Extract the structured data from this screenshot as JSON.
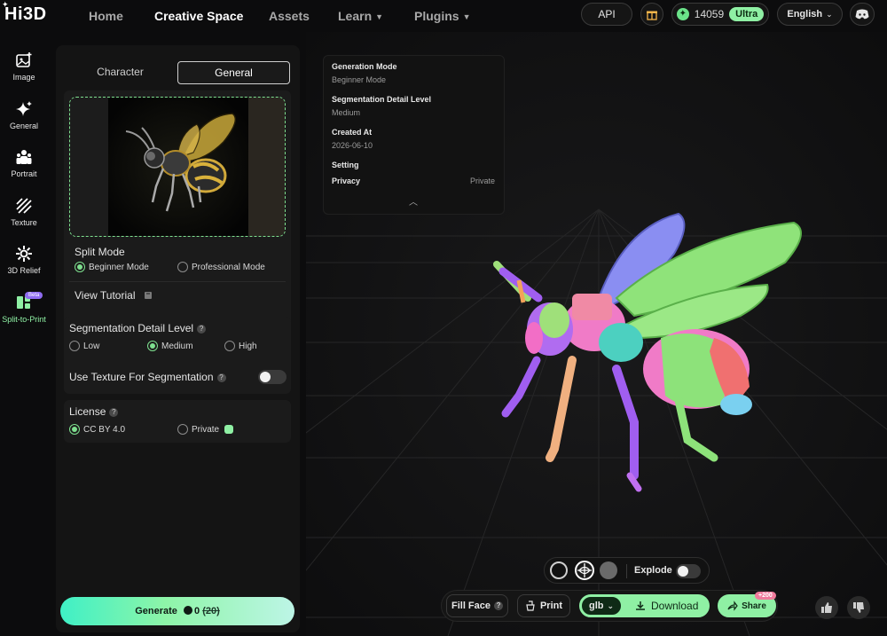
{
  "app": {
    "logo": "Hi3D"
  },
  "nav": {
    "items": [
      {
        "label": "Home"
      },
      {
        "label": "Creative Space"
      },
      {
        "label": "Assets"
      },
      {
        "label": "Learn"
      },
      {
        "label": "Plugins"
      }
    ],
    "api_label": "API",
    "credits": "14059",
    "plan_badge": "Ultra",
    "language": "English"
  },
  "rail": {
    "items": [
      {
        "label": "Image"
      },
      {
        "label": "General"
      },
      {
        "label": "Portrait"
      },
      {
        "label": "Texture"
      },
      {
        "label": "3D Relief"
      },
      {
        "label": "Split-to-Print",
        "badge": "Beta"
      }
    ]
  },
  "panel": {
    "tabs": [
      {
        "label": "Character"
      },
      {
        "label": "General"
      }
    ],
    "split_mode": {
      "title": "Split Mode",
      "options": [
        {
          "label": "Beginner Mode",
          "selected": true
        },
        {
          "label": "Professional Mode",
          "selected": false
        }
      ],
      "tutorial": "View Tutorial"
    },
    "segmentation": {
      "title": "Segmentation Detail Level",
      "options": [
        {
          "label": "Low",
          "selected": false
        },
        {
          "label": "Medium",
          "selected": true
        },
        {
          "label": "High",
          "selected": false
        }
      ]
    },
    "texture_toggle": {
      "label": "Use Texture For Segmentation",
      "on": false
    },
    "license": {
      "title": "License",
      "options": [
        {
          "label": "CC BY 4.0",
          "selected": true
        },
        {
          "label": "Private",
          "selected": false
        }
      ]
    },
    "generate": {
      "label": "Generate",
      "cost": "0",
      "original_cost": "(20)"
    }
  },
  "info_card": {
    "generation_mode_label": "Generation Mode",
    "generation_mode_value": "Beginner Mode",
    "segmentation_label": "Segmentation Detail Level",
    "segmentation_value": "Medium",
    "created_label": "Created At",
    "created_value": "2026-06-10",
    "setting_label": "Setting",
    "privacy_label": "Privacy",
    "privacy_value": "Private"
  },
  "viewer": {
    "explode_label": "Explode",
    "explode_on": false,
    "fill_face": "Fill Face",
    "print": "Print",
    "format": "glb",
    "download": "Download",
    "share": "Share",
    "share_bonus": "+200"
  },
  "colors": {
    "accent": "#8ff0a4",
    "background": "#0c0c0d",
    "panel": "#141414"
  }
}
